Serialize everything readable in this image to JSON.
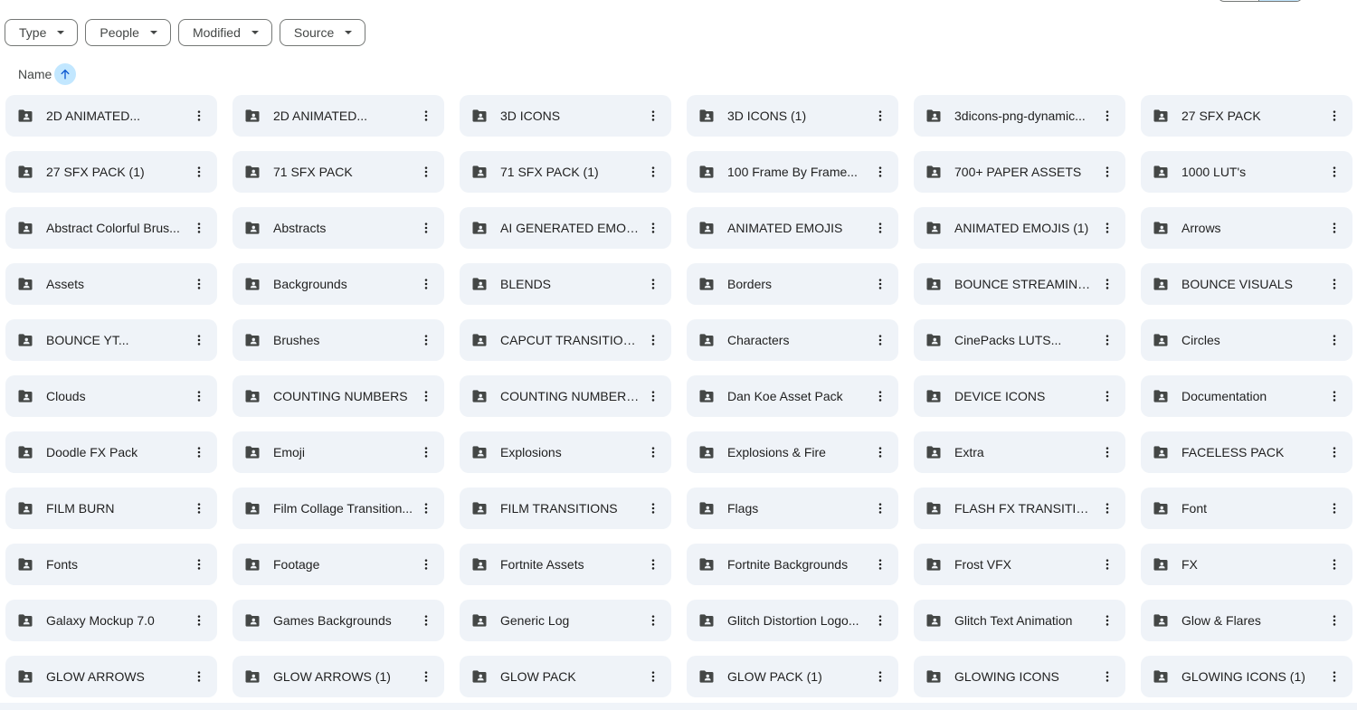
{
  "filters": [
    {
      "label": "Type"
    },
    {
      "label": "People"
    },
    {
      "label": "Modified"
    },
    {
      "label": "Source"
    }
  ],
  "sort": {
    "label": "Name",
    "direction_icon": "arrow-upward-icon"
  },
  "folder_icon": "shared-folder-icon",
  "more_icon": "more-vertical-icon",
  "colors": {
    "card_bg": "#eff3f8",
    "sort_highlight": "#c2e7ff",
    "icon": "#444746",
    "text": "#1f1f1f"
  },
  "folders": [
    "2D ANIMATED...",
    "2D ANIMATED...",
    "3D ICONS",
    "3D ICONS (1)",
    "3dicons-png-dynamic...",
    "27 SFX PACK",
    "27 SFX PACK (1)",
    "71 SFX PACK",
    "71 SFX PACK (1)",
    "100 Frame By Frame...",
    "700+ PAPER ASSETS",
    "1000 LUT's",
    "Abstract Colorful Brus...",
    "Abstracts",
    "AI GENERATED EMOJIS",
    "ANIMATED EMOJIS",
    "ANIMATED EMOJIS (1)",
    "Arrows",
    "Assets",
    "Backgrounds",
    "BLENDS",
    "Borders",
    "BOUNCE STREAMING...",
    "BOUNCE VISUALS",
    "BOUNCE YT...",
    "Brushes",
    "CAPCUT TRANSITIONS",
    "Characters",
    "CinePacks LUTS...",
    "Circles",
    "Clouds",
    "COUNTING NUMBERS",
    "COUNTING NUMBERS...",
    "Dan Koe Asset Pack",
    "DEVICE ICONS",
    "Documentation",
    "Doodle FX Pack",
    "Emoji",
    "Explosions",
    "Explosions & Fire",
    "Extra",
    "FACELESS PACK",
    "FILM BURN",
    "Film Collage Transition...",
    "FILM TRANSITIONS",
    "Flags",
    "FLASH FX TRANSITION",
    "Font",
    "Fonts",
    "Footage",
    "Fortnite Assets",
    "Fortnite Backgrounds",
    "Frost VFX",
    "FX",
    "Galaxy Mockup 7.0",
    "Games Backgrounds",
    "Generic Log",
    "Glitch Distortion Logo...",
    "Glitch Text Animation",
    "Glow & Flares",
    "GLOW ARROWS",
    "GLOW ARROWS (1)",
    "GLOW PACK",
    "GLOW PACK (1)",
    "GLOWING ICONS",
    "GLOWING ICONS (1)"
  ]
}
